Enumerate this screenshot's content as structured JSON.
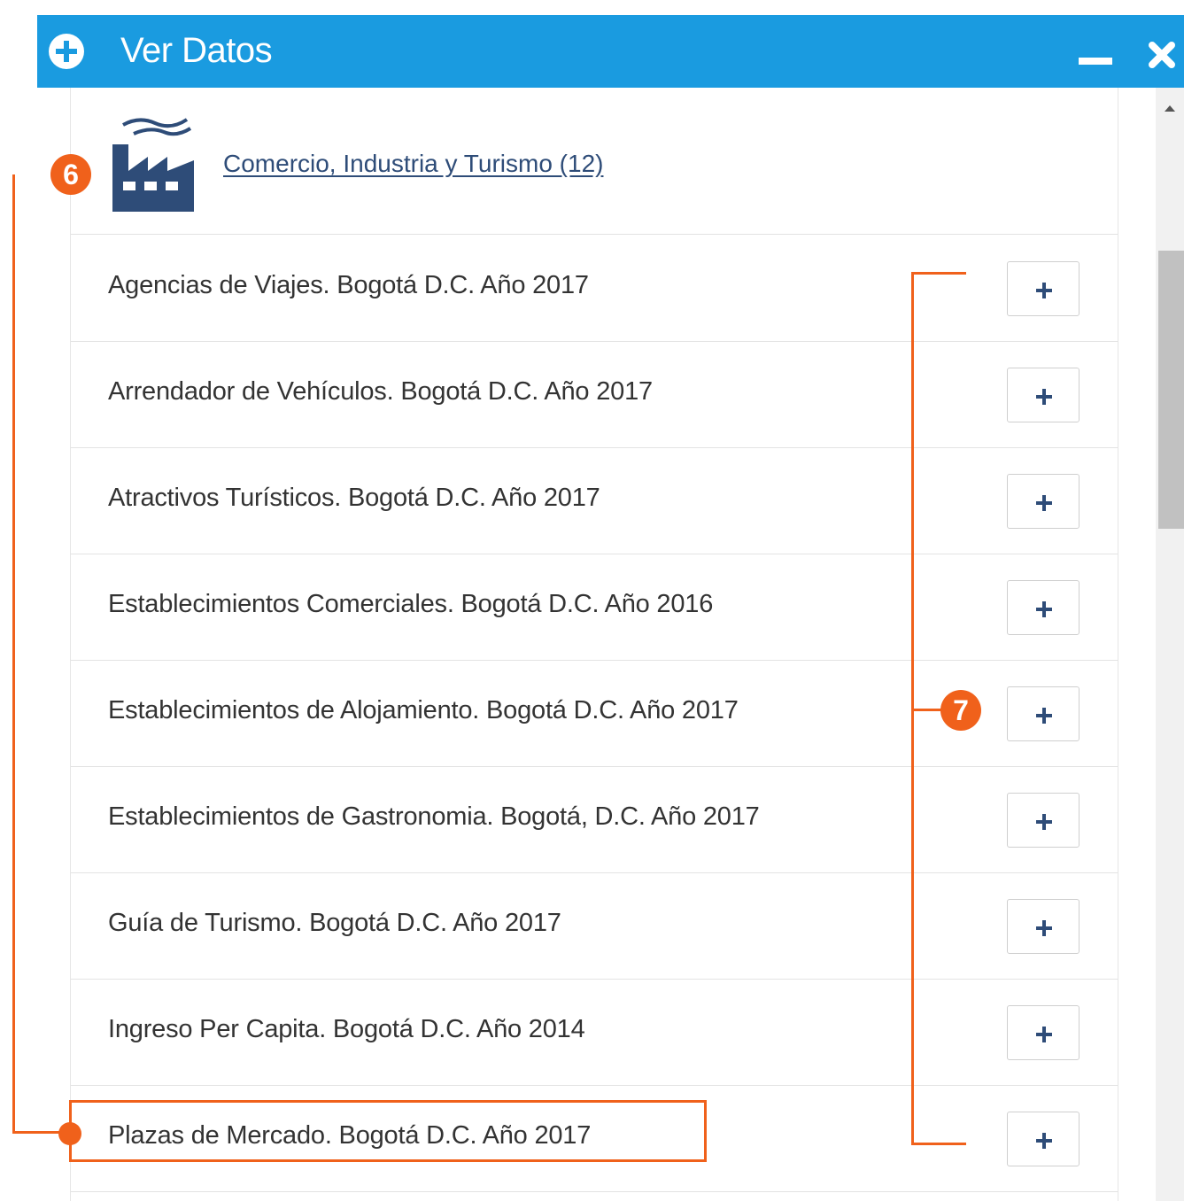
{
  "window": {
    "title": "Ver Datos",
    "title_icon": "plus-circle-icon",
    "controls": [
      "minimize-icon",
      "close-icon"
    ],
    "accent_color": "#1a9be0"
  },
  "category": {
    "icon": "factory-icon",
    "link_text": "Comercio, Industria y Turismo (12)",
    "color": "#2e4c78"
  },
  "datasets": [
    {
      "label": "Agencias de Viajes. Bogotá D.C. Año 2017"
    },
    {
      "label": "Arrendador de Vehículos. Bogotá D.C. Año 2017"
    },
    {
      "label": "Atractivos Turísticos. Bogotá D.C. Año 2017"
    },
    {
      "label": "Establecimientos Comerciales. Bogotá D.C. Año 2016"
    },
    {
      "label": "Establecimientos de Alojamiento. Bogotá D.C. Año 2017"
    },
    {
      "label": "Establecimientos de Gastronomia. Bogotá, D.C. Año 2017"
    },
    {
      "label": "Guía de Turismo. Bogotá D.C. Año 2017"
    },
    {
      "label": "Ingreso Per Capita. Bogotá D.C. Año 2014"
    },
    {
      "label": "Plazas de Mercado. Bogotá D.C. Año 2017"
    }
  ],
  "annotations": {
    "badge_6": "6",
    "badge_7": "7",
    "color": "#f0611b"
  }
}
